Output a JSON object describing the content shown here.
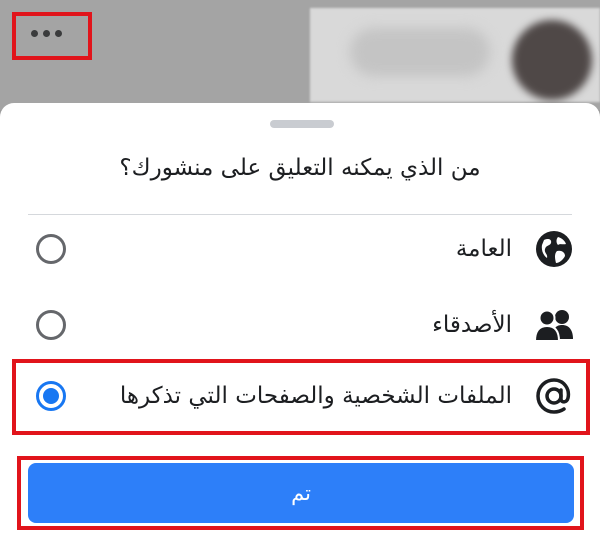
{
  "header": {
    "more_icon": "more-dots-icon"
  },
  "sheet": {
    "title": "من الذي يمكنه التعليق على منشورك؟",
    "options": [
      {
        "label": "العامة",
        "icon": "globe-icon",
        "selected": false
      },
      {
        "label": "الأصدقاء",
        "icon": "friends-icon",
        "selected": false
      },
      {
        "label": "الملفات الشخصية والصفحات التي تذكرها",
        "icon": "at-sign-icon",
        "selected": true
      }
    ],
    "done_label": "تم"
  },
  "colors": {
    "accent": "#1877f2",
    "button": "#2d7ff9",
    "highlight": "#e1141b"
  }
}
